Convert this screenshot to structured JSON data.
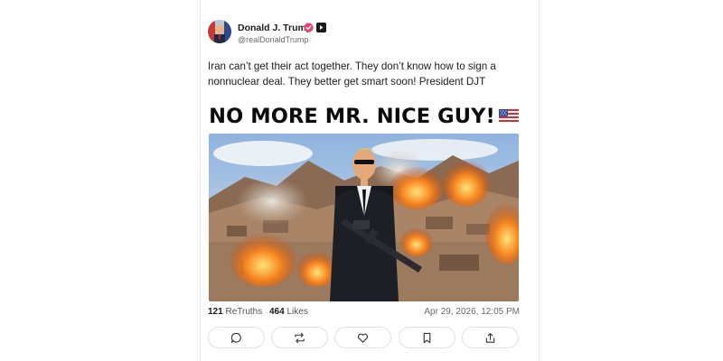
{
  "post": {
    "author": {
      "display_name": "Donald J. Trump",
      "handle": "@realDonaldTrump",
      "avatar_icon": "avatar-photo",
      "verified_badge": "verified-check-icon",
      "affiliate_badge": "truth-plus-icon",
      "badge_color": "#e0457b"
    },
    "text": "Iran can’t get their act together. They don’t know how to sign a nonnuclear deal. They better get smart soon! President DJT",
    "image": {
      "title": "NO MORE MR. NICE GUY!",
      "flag_icon": "us-flag-emoji"
    },
    "stats": {
      "retruths_count": "121",
      "retruths_label": "ReTruths",
      "likes_count": "464",
      "likes_label": "Likes",
      "timestamp": "Apr 29, 2026, 12:05 PM"
    },
    "actions": [
      {
        "name": "reply",
        "icon": "comment-icon"
      },
      {
        "name": "retruth",
        "icon": "repost-icon"
      },
      {
        "name": "like",
        "icon": "heart-icon"
      },
      {
        "name": "bookmark",
        "icon": "bookmark-icon"
      },
      {
        "name": "share",
        "icon": "share-icon"
      }
    ]
  }
}
